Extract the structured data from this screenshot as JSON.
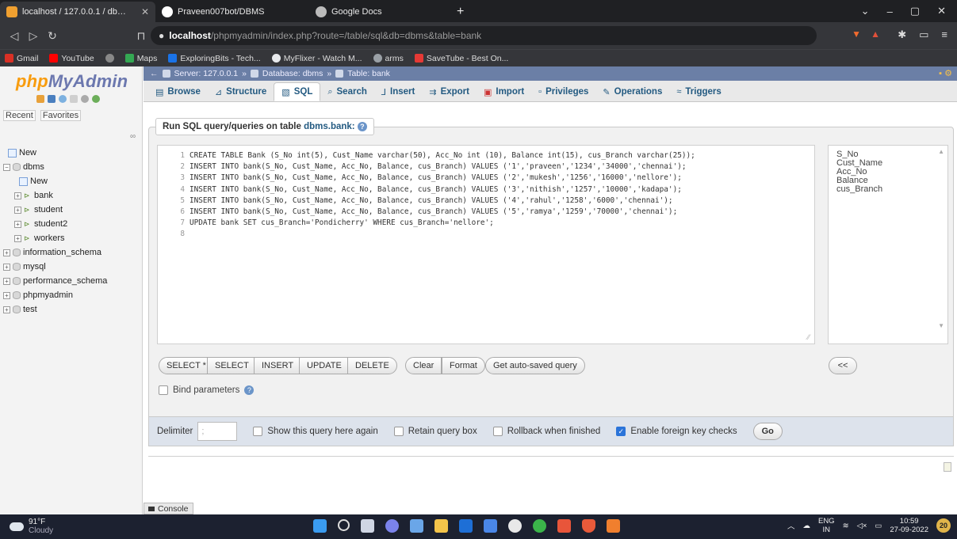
{
  "browser": {
    "tabs": [
      {
        "title": "localhost / 127.0.0.1 / dbms / ban",
        "active": true,
        "icon": "phpmyadmin-icon"
      },
      {
        "title": "Praveen007bot/DBMS",
        "active": false,
        "icon": "github-icon"
      },
      {
        "title": "Google Docs",
        "active": false,
        "icon": "google-docs-icon"
      }
    ],
    "new_tab": "+",
    "url_host": "localhost",
    "url_path": "/phpmyadmin/index.php?route=/table/sql&db=dbms&table=bank",
    "bookmarks": [
      {
        "label": "Gmail",
        "color": "#d93025"
      },
      {
        "label": "YouTube",
        "color": "#ff0000"
      },
      {
        "label": "",
        "color": "#888888"
      },
      {
        "label": "Maps",
        "color": "#34a853"
      },
      {
        "label": "ExploringBits - Tech...",
        "color": "#1a73e8"
      },
      {
        "label": "MyFlixer - Watch M...",
        "color": "#e8eaed"
      },
      {
        "label": "arms",
        "color": "#9aa0a6"
      },
      {
        "label": "SaveTube - Best On...",
        "color": "#e53935"
      }
    ]
  },
  "nav": {
    "logo_php": "php",
    "logo_rest": "MyAdmin",
    "recent": "Recent",
    "favorites": "Favorites",
    "tree": [
      {
        "label": "New",
        "level": 0,
        "type": "new"
      },
      {
        "label": "dbms",
        "level": 0,
        "type": "db"
      },
      {
        "label": "New",
        "level": 1,
        "type": "new"
      },
      {
        "label": "bank",
        "level": 1,
        "type": "table"
      },
      {
        "label": "student",
        "level": 1,
        "type": "table"
      },
      {
        "label": "student2",
        "level": 1,
        "type": "table"
      },
      {
        "label": "workers",
        "level": 1,
        "type": "table"
      },
      {
        "label": "information_schema",
        "level": 0,
        "type": "db"
      },
      {
        "label": "mysql",
        "level": 0,
        "type": "db"
      },
      {
        "label": "performance_schema",
        "level": 0,
        "type": "db"
      },
      {
        "label": "phpmyadmin",
        "level": 0,
        "type": "db"
      },
      {
        "label": "test",
        "level": 0,
        "type": "db"
      }
    ]
  },
  "breadcrumb": {
    "server": "Server: 127.0.0.1",
    "database": "Database: dbms",
    "table": "Table: bank"
  },
  "tabs": [
    {
      "label": "Browse",
      "icon": "browse-icon",
      "active": false
    },
    {
      "label": "Structure",
      "icon": "structure-icon",
      "active": false
    },
    {
      "label": "SQL",
      "icon": "sql-icon",
      "active": true
    },
    {
      "label": "Search",
      "icon": "search-icon",
      "active": false
    },
    {
      "label": "Insert",
      "icon": "insert-icon",
      "active": false
    },
    {
      "label": "Export",
      "icon": "export-icon",
      "active": false
    },
    {
      "label": "Import",
      "icon": "import-icon",
      "active": false
    },
    {
      "label": "Privileges",
      "icon": "privileges-icon",
      "active": false
    },
    {
      "label": "Operations",
      "icon": "operations-icon",
      "active": false
    },
    {
      "label": "Triggers",
      "icon": "triggers-icon",
      "active": false
    }
  ],
  "sql": {
    "legend_prefix": "Run SQL query/queries on table ",
    "legend_table": "dbms.bank:",
    "lines": [
      "CREATE TABLE Bank (S_No int(5), Cust_Name varchar(50), Acc_No int (10), Balance int(15), cus_Branch varchar(25));",
      "INSERT INTO bank(S_No, Cust_Name, Acc_No, Balance, cus_Branch) VALUES ('1','praveen','1234','34000','chennai');",
      "INSERT INTO bank(S_No, Cust_Name, Acc_No, Balance, cus_Branch) VALUES ('2','mukesh','1256','16000','nellore');",
      "INSERT INTO bank(S_No, Cust_Name, Acc_No, Balance, cus_Branch) VALUES ('3','nithish','1257','10000','kadapa');",
      "INSERT INTO bank(S_No, Cust_Name, Acc_No, Balance, cus_Branch) VALUES ('4','rahul','1258','6000','chennai');",
      "INSERT INTO bank(S_No, Cust_Name, Acc_No, Balance, cus_Branch) VALUES ('5','ramya','1259','70000','chennai');",
      "UPDATE bank SET cus_Branch='Pondicherry' WHERE cus_Branch='nellore';",
      ""
    ],
    "columns": [
      "S_No",
      "Cust_Name",
      "Acc_No",
      "Balance",
      "cus_Branch"
    ],
    "buttons": {
      "select_star": "SELECT *",
      "select": "SELECT",
      "insert": "INSERT",
      "update": "UPDATE",
      "delete": "DELETE",
      "clear": "Clear",
      "format": "Format",
      "autosaved": "Get auto-saved query",
      "insert_col": "<<"
    },
    "bind_parameters": "Bind parameters",
    "delimiter_label": "Delimiter",
    "delimiter_value": ";",
    "show_query": "Show this query here again",
    "retain_box": "Retain query box",
    "rollback": "Rollback when finished",
    "foreign_key": "Enable foreign key checks",
    "foreign_key_checked": true,
    "go": "Go"
  },
  "console": "Console",
  "taskbar": {
    "temp": "91°F",
    "weather": "Cloudy",
    "lang1": "ENG",
    "lang2": "IN",
    "time": "10:59",
    "date": "27-09-2022",
    "notifications": "20"
  }
}
